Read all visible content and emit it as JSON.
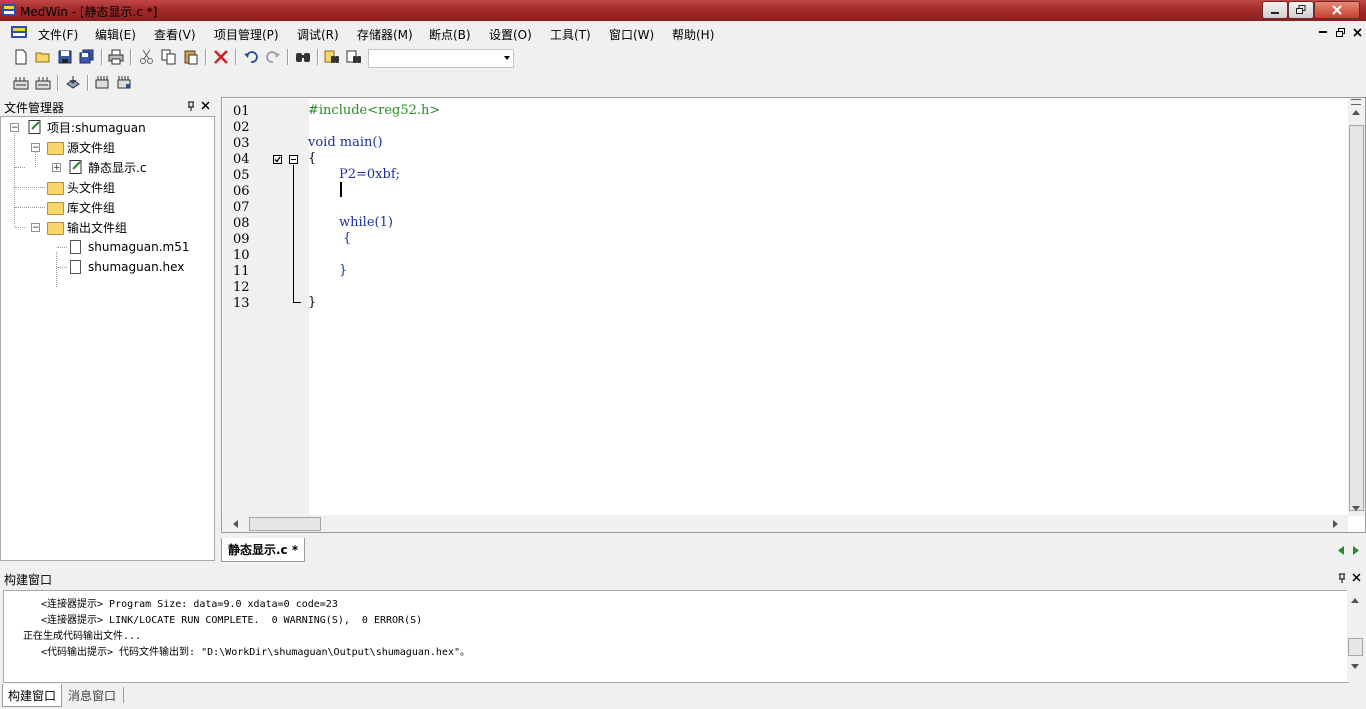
{
  "window": {
    "title": "MedWin - [静态显示.c *]"
  },
  "menu": [
    "文件(F)",
    "编辑(E)",
    "查看(V)",
    "项目管理(P)",
    "调试(R)",
    "存储器(M)",
    "断点(B)",
    "设置(O)",
    "工具(T)",
    "窗口(W)",
    "帮助(H)"
  ],
  "file_manager": {
    "title": "文件管理器",
    "tree": {
      "project": "项目:shumaguan",
      "source_group": "源文件组",
      "source_file": "静态显示.c",
      "header_group": "头文件组",
      "library_group": "库文件组",
      "output_group": "输出文件组",
      "output_files": [
        "shumaguan.m51",
        "shumaguan.hex"
      ]
    }
  },
  "editor": {
    "line_numbers": [
      "01",
      "02",
      "03",
      "04",
      "05",
      "06",
      "07",
      "08",
      "09",
      "10",
      "11",
      "12",
      "13"
    ],
    "code": {
      "l1": "#include<reg52.h>",
      "l3": "void main()",
      "l4": "{",
      "l5": "P2=0xbf;",
      "l8": "while(1)",
      "l9": "{",
      "l11": "}",
      "l13": "}"
    },
    "tab_label": "静态显示.c *"
  },
  "build": {
    "title": "构建窗口",
    "lines": [
      "<连接器提示> Program Size: data=9.0 xdata=0 code=23",
      "<连接器提示> LINK/LOCATE RUN COMPLETE.  0 WARNING(S),  0 ERROR(S)",
      "正在生成代码输出文件...",
      "<代码输出提示> 代码文件输出到: \"D:\\WorkDir\\shumaguan\\Output\\shumaguan.hex\"。"
    ],
    "tabs": [
      "构建窗口",
      "消息窗口"
    ]
  }
}
